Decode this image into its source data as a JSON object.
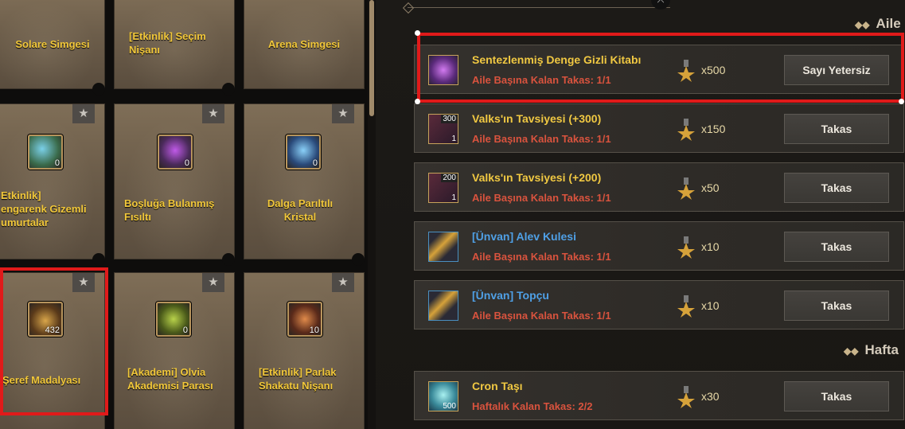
{
  "left_grid": {
    "cells": [
      {
        "label": "Solare Simgesi",
        "qty": ""
      },
      {
        "label": "[Etkinlik] Seçim\nNişanı",
        "qty": ""
      },
      {
        "label": "Arena Simgesi",
        "qty": ""
      },
      {
        "label": "Etkinlik]\nengarenk Gizemli\numurtalar",
        "qty": "0"
      },
      {
        "label": "Boşluğa Bulanmış\nFısıltı",
        "qty": "0"
      },
      {
        "label": "Dalga Parıltılı\nKristal",
        "qty": "0"
      },
      {
        "label": "Şeref Madalyası",
        "qty": "432"
      },
      {
        "label": "[Akademi] Olvia\nAkademisi Parası",
        "qty": "0"
      },
      {
        "label": "[Etkinlik] Parlak\nShakatu Nişanı",
        "qty": "10"
      }
    ],
    "star_glyph": "★"
  },
  "sections": [
    {
      "title": "Aile"
    },
    {
      "title": "Hafta"
    }
  ],
  "top_knob": "⤫",
  "exchange_rows": [
    {
      "title": "Sentezlenmiş Denge Gizli Kitabı",
      "subtitle": "Aile Başına Kalan Takas: 1/1",
      "cost": "x500",
      "button": "Sayı Yetersiz",
      "badge_top": "",
      "badge_bot": ""
    },
    {
      "title": "Valks'ın Tavsiyesi (+300)",
      "subtitle": "Aile Başına Kalan Takas: 1/1",
      "cost": "x150",
      "button": "Takas",
      "badge_top": "300",
      "badge_bot": "1"
    },
    {
      "title": "Valks'ın Tavsiyesi (+200)",
      "subtitle": "Aile Başına Kalan Takas: 1/1",
      "cost": "x50",
      "button": "Takas",
      "badge_top": "200",
      "badge_bot": "1"
    },
    {
      "title": "[Ünvan] Alev Kulesi",
      "subtitle": "Aile Başına Kalan Takas: 1/1",
      "cost": "x10",
      "button": "Takas",
      "badge_top": "",
      "badge_bot": ""
    },
    {
      "title": "[Ünvan] Topçu",
      "subtitle": "Aile Başına Kalan Takas: 1/1",
      "cost": "x10",
      "button": "Takas",
      "badge_top": "",
      "badge_bot": ""
    },
    {
      "title": "Cron Taşı",
      "subtitle": "Haftalık Kalan Takas: 2/2",
      "cost": "x30",
      "button": "Takas",
      "badge_top": "",
      "badge_bot": "500"
    }
  ],
  "colors": {
    "highlight": "#e01a1a",
    "title_gold": "#f0c842",
    "title_blue": "#4fa0e6",
    "limit_red": "#d9533e"
  }
}
